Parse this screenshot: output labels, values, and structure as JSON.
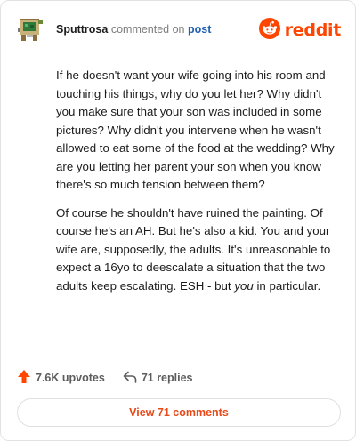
{
  "header": {
    "username": "Sputtrosa",
    "action_text": "commented on",
    "post_link": "post",
    "brand_name": "reddit"
  },
  "icons": {
    "avatar": "pixel-avatar-icon",
    "brand": "reddit-snoo-icon",
    "upvote": "upvote-arrow-icon",
    "reply": "reply-arrow-icon"
  },
  "comment": {
    "paragraph1": "If he doesn't want your wife going into his room and touching his things, why do you let her? Why didn't you make sure that your son was included in some pictures? Why didn't you intervene when he wasn't allowed to eat some of the food at the wedding? Why are you letting her parent your son when you know there's so much tension between them?",
    "paragraph2_main": "Of course he shouldn't have ruined the painting. Of course he's an AH. But he's also a kid. You and your wife are, supposedly, the adults. It's unreasonable to expect a 16yo to deescalate a situation that the two adults keep escalating. ESH - but ",
    "paragraph2_emph": "you",
    "paragraph2_end": " in particular."
  },
  "footer": {
    "upvotes": "7.6K upvotes",
    "replies": "71 replies",
    "view_button": "View 71 comments"
  },
  "colors": {
    "brand": "#ff4500",
    "link": "#1e5fb3",
    "view_button_text": "#e84a1a"
  }
}
